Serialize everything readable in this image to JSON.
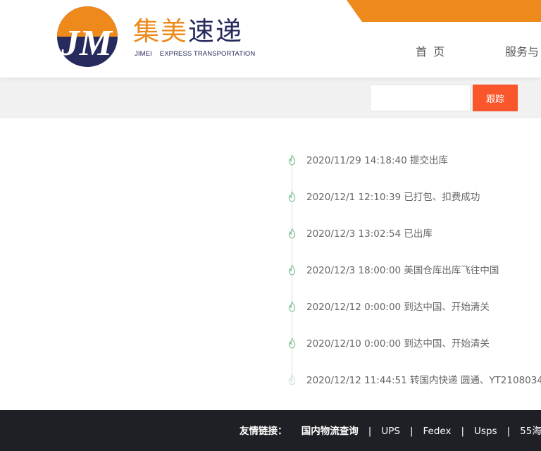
{
  "brand": {
    "name_part1": "集美",
    "name_part2": "速递",
    "en_part1": "JIMEI",
    "en_part2": "EXPRESS TRANSPORTATION",
    "logo_letters": "JM",
    "colors": {
      "orange": "#ee8a1c",
      "navy": "#262a5c"
    }
  },
  "nav": {
    "home": "首 页",
    "service": "服务与"
  },
  "search": {
    "value": "",
    "placeholder": "",
    "button_label": "跟踪",
    "button_color": "#f9562b"
  },
  "tracking": {
    "events": [
      {
        "text": "2020/11/29 14:18:40 提交出库",
        "icon": "flame-icon"
      },
      {
        "text": "2020/12/1 12:10:39 已打包、扣费成功",
        "icon": "flame-icon"
      },
      {
        "text": "2020/12/3 13:02:54 已出库",
        "icon": "flame-icon"
      },
      {
        "text": "2020/12/3 18:00:00 美国仓库出库飞往中国",
        "icon": "flame-icon"
      },
      {
        "text": "2020/12/12 0:00:00 到达中国、开始清关",
        "icon": "flame-icon"
      },
      {
        "text": "2020/12/10 0:00:00 到达中国、开始清关",
        "icon": "flame-icon"
      },
      {
        "text": "2020/12/12 11:44:51 转国内快递 圆通、YT2108034",
        "icon": "flame-icon"
      }
    ]
  },
  "footer": {
    "label": "友情链接：",
    "links": [
      "国内物流查询",
      "UPS",
      "Fedex",
      "Usps",
      "55海"
    ],
    "separator": "|"
  }
}
